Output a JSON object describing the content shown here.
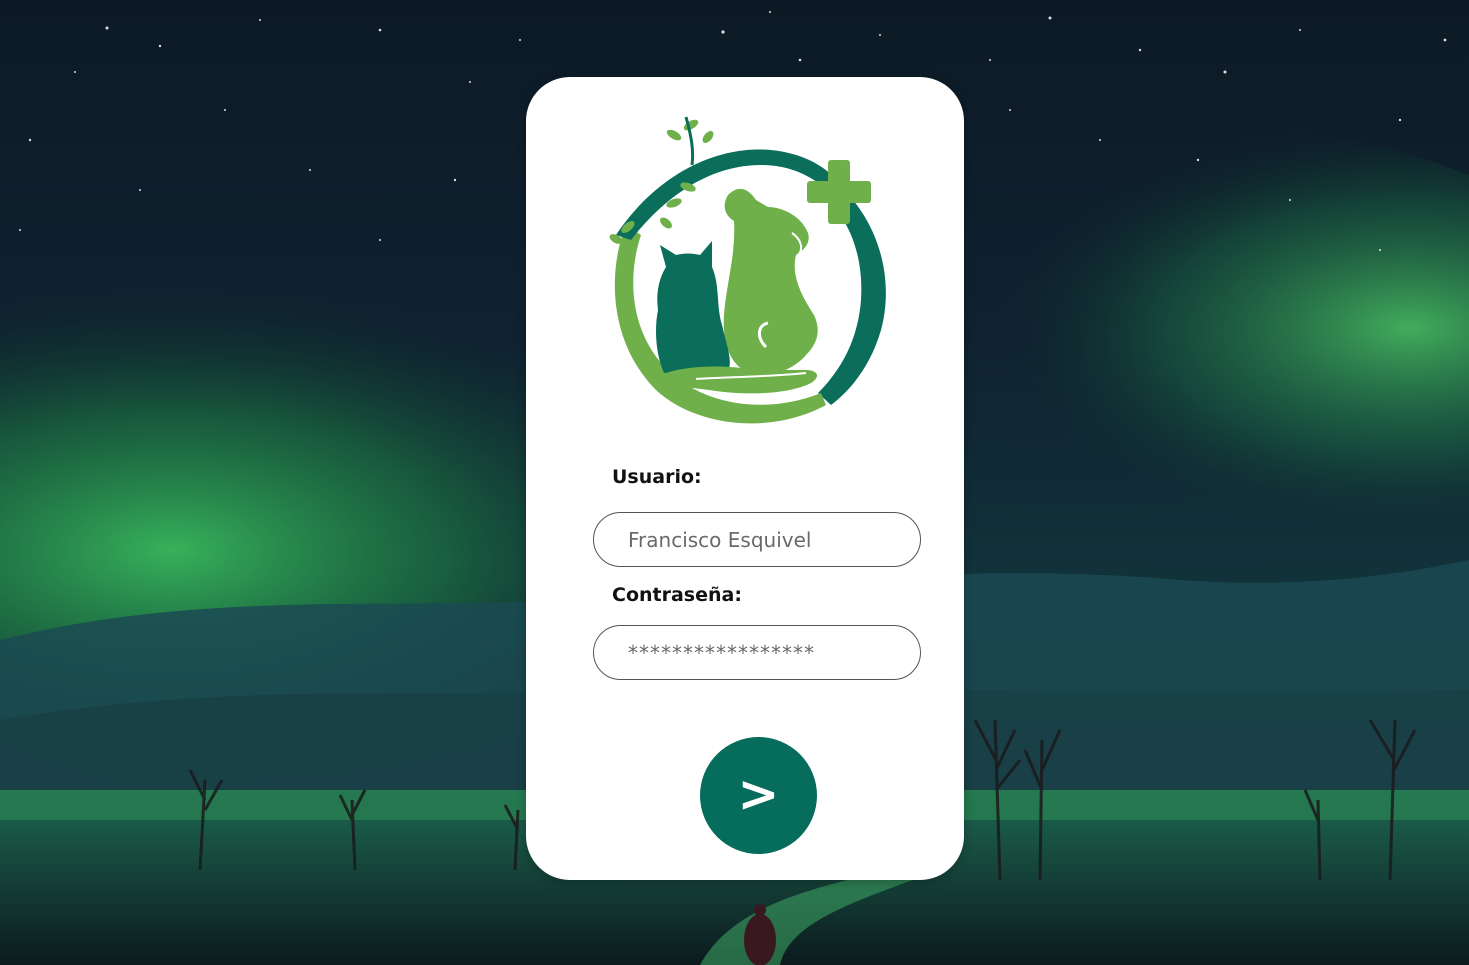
{
  "login": {
    "user_label": "Usuario:",
    "user_value": "Francisco Esquivel",
    "password_label": "Contraseña:",
    "password_value": "*****************",
    "submit_label": ">"
  },
  "logo": {
    "icon": "veterinary-logo-icon",
    "colors": {
      "dark_green": "#0a6e5a",
      "light_green": "#6fb04a"
    }
  },
  "background": {
    "description_icon": "aurora-night-landscape",
    "colors": {
      "sky": "#0b1a24",
      "aurora": "#2f9a4a"
    }
  },
  "theme": {
    "accent": "#066c5c",
    "card": "#ffffff"
  }
}
